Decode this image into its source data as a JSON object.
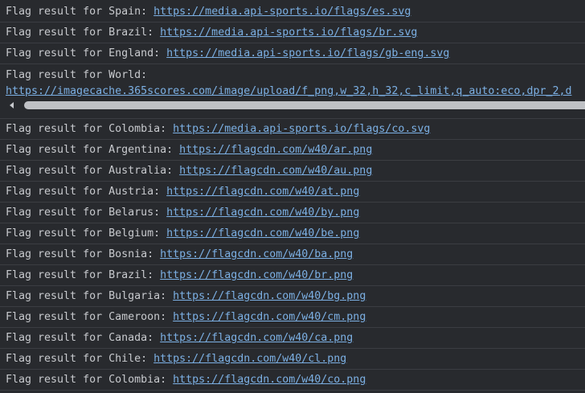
{
  "console": {
    "rows": [
      {
        "prefix": "Flag result for Spain:",
        "url": "https://media.api-sports.io/flags/es.svg"
      },
      {
        "prefix": "Flag result for Brazil:",
        "url": "https://media.api-sports.io/flags/br.svg"
      },
      {
        "prefix": "Flag result for England:",
        "url": "https://media.api-sports.io/flags/gb-eng.svg"
      },
      {
        "prefix": "Flag result for World:",
        "url": "https://imagecache.365scores.com/image/upload/f_png,w_32,h_32,c_limit,q_auto:eco,dpr_2,d"
      },
      {
        "prefix": "Flag result for Colombia:",
        "url": "https://media.api-sports.io/flags/co.svg"
      },
      {
        "prefix": "Flag result for Argentina:",
        "url": "https://flagcdn.com/w40/ar.png"
      },
      {
        "prefix": "Flag result for Australia:",
        "url": "https://flagcdn.com/w40/au.png"
      },
      {
        "prefix": "Flag result for Austria:",
        "url": "https://flagcdn.com/w40/at.png"
      },
      {
        "prefix": "Flag result for Belarus:",
        "url": "https://flagcdn.com/w40/by.png"
      },
      {
        "prefix": "Flag result for Belgium:",
        "url": "https://flagcdn.com/w40/be.png"
      },
      {
        "prefix": "Flag result for Bosnia:",
        "url": "https://flagcdn.com/w40/ba.png"
      },
      {
        "prefix": "Flag result for Brazil:",
        "url": "https://flagcdn.com/w40/br.png"
      },
      {
        "prefix": "Flag result for Bulgaria:",
        "url": "https://flagcdn.com/w40/bg.png"
      },
      {
        "prefix": "Flag result for Cameroon:",
        "url": "https://flagcdn.com/w40/cm.png"
      },
      {
        "prefix": "Flag result for Canada:",
        "url": "https://flagcdn.com/w40/ca.png"
      },
      {
        "prefix": "Flag result for Chile:",
        "url": "https://flagcdn.com/w40/cl.png"
      },
      {
        "prefix": "Flag result for Colombia:",
        "url": "https://flagcdn.com/w40/co.png"
      }
    ]
  },
  "icons": {
    "scroll_left": "scroll-left-arrow-icon"
  },
  "colors": {
    "background": "#282a2e",
    "text": "#c8cace",
    "link": "#7cb0e4",
    "divider": "#3b3d42"
  }
}
